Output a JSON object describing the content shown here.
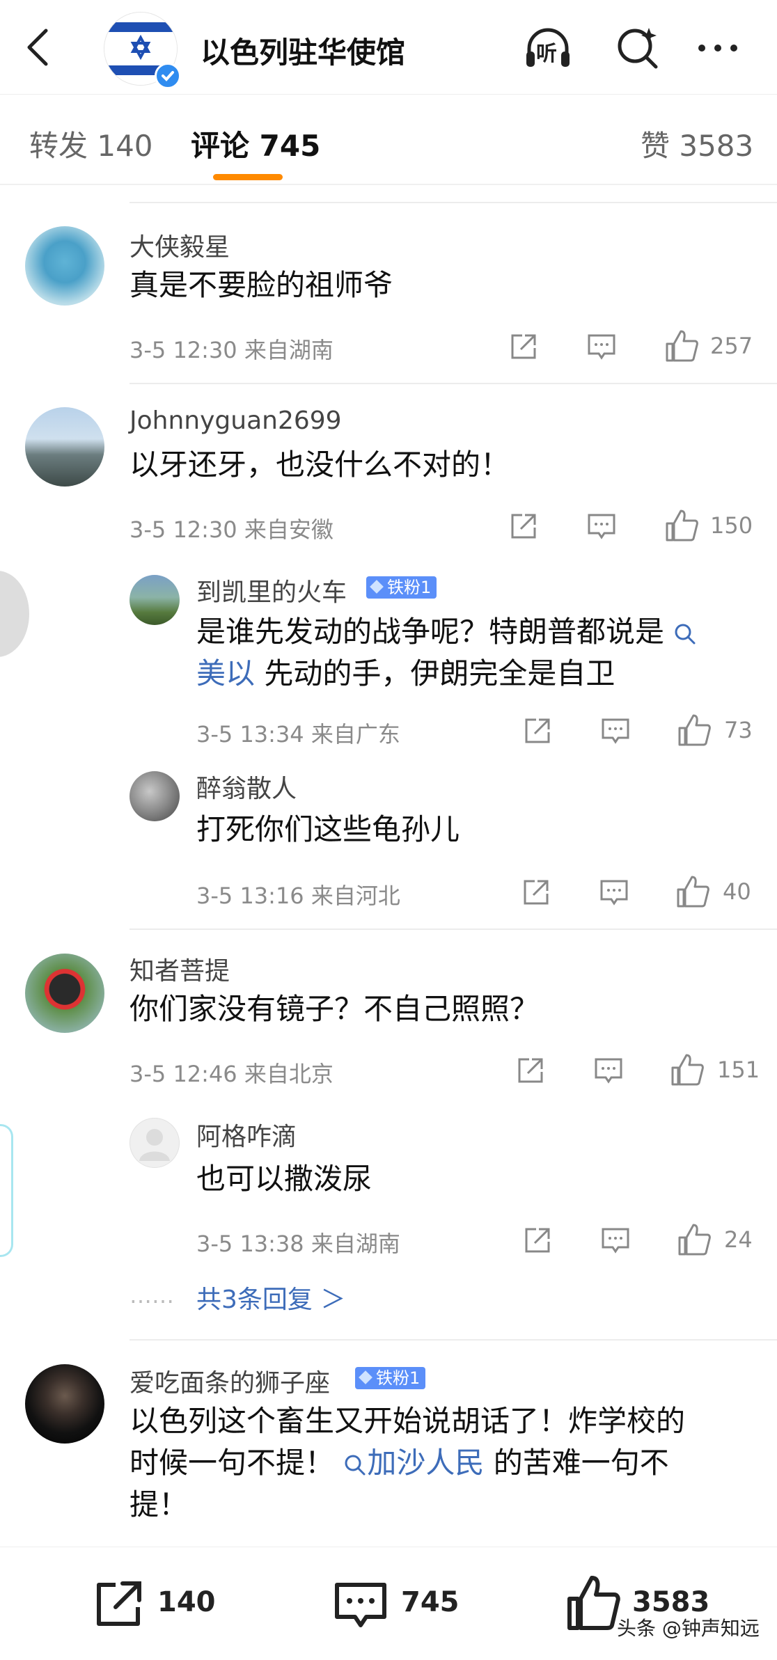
{
  "header": {
    "title": "以色列驻华使馆",
    "icons": [
      "back-icon",
      "listen-icon",
      "search-icon",
      "more-icon"
    ],
    "listen_label": "听"
  },
  "tabs": {
    "repost": "转发 140",
    "comments": "评论 745",
    "likes": "赞 3583"
  },
  "comments": [
    {
      "user": "大侠毅星",
      "text": "真是不要脸的祖师爷",
      "meta": "3-5 12:30  来自湖南",
      "likes": "257"
    },
    {
      "user": "Johnnyguan2699",
      "text": "以牙还牙，也没什么不对的！",
      "meta": "3-5 12:30  来自安徽",
      "likes": "150",
      "replies": [
        {
          "user": "到凯里的火车",
          "badge": "铁粉1",
          "text_line1": "是谁先发动的战争呢？特朗普都说是",
          "link": "美以",
          "text_line2": "先动的手，伊朗完全是自卫",
          "meta": "3-5 13:34  来自广东",
          "likes": "73"
        },
        {
          "user": "醉翁散人",
          "text": "打死你们这些龟孙儿",
          "meta": "3-5 13:16  来自河北",
          "likes": "40"
        }
      ]
    },
    {
      "user": "知者菩提",
      "text": "你们家没有镜子？不自己照照？",
      "meta": "3-5 12:46  来自北京",
      "likes": "151",
      "replies": [
        {
          "user": "阿格咋滴",
          "text": "也可以撒泼尿",
          "meta": "3-5 13:38  来自湖南",
          "likes": "24"
        }
      ],
      "more_replies": "共3条回复 ＞",
      "more_dots": "……"
    },
    {
      "user": "爱吃面条的狮子座",
      "badge": "铁粉1",
      "text_line1": "以色列这个畜生又开始说胡话了！炸学校的",
      "text_line2_a": "时候一句不提！",
      "link": "加沙人民",
      "text_line2_b": "的苦难一句不",
      "text_line3": "提！"
    }
  ],
  "bottom_bar": {
    "repost_count": "140",
    "comment_count": "745",
    "like_count": "3583"
  },
  "watermark": "头条 @钟声知远",
  "colors": {
    "accent": "#ff8a00",
    "link": "#3d6cb9",
    "badge": "#5b8ff9",
    "verified": "#2f8cf0"
  }
}
